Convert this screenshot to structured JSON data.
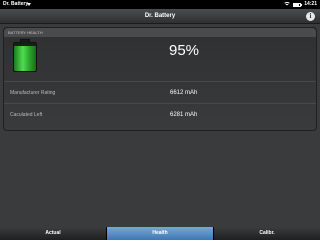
{
  "status_bar": {
    "app_name": "Dr. Battery",
    "time": "14:21",
    "battery_fraction": 0.85
  },
  "header": {
    "title": "Dr. Battery",
    "info_glyph": "i"
  },
  "group": {
    "label": "BATTERY HEALTH",
    "percent": "95%",
    "rows": [
      {
        "label": "Manufacturer Rating",
        "value": "6612 mAh"
      },
      {
        "label": "Caculated Left",
        "value": "6281 mAh"
      }
    ]
  },
  "tabs": [
    {
      "label": "Actual",
      "active": false
    },
    {
      "label": "Health",
      "active": true
    },
    {
      "label": "Calibr.",
      "active": false
    }
  ],
  "colors": {
    "accent": "#4f84c0",
    "battery_green": "#3cc63c",
    "background": "#3a3b3c"
  }
}
